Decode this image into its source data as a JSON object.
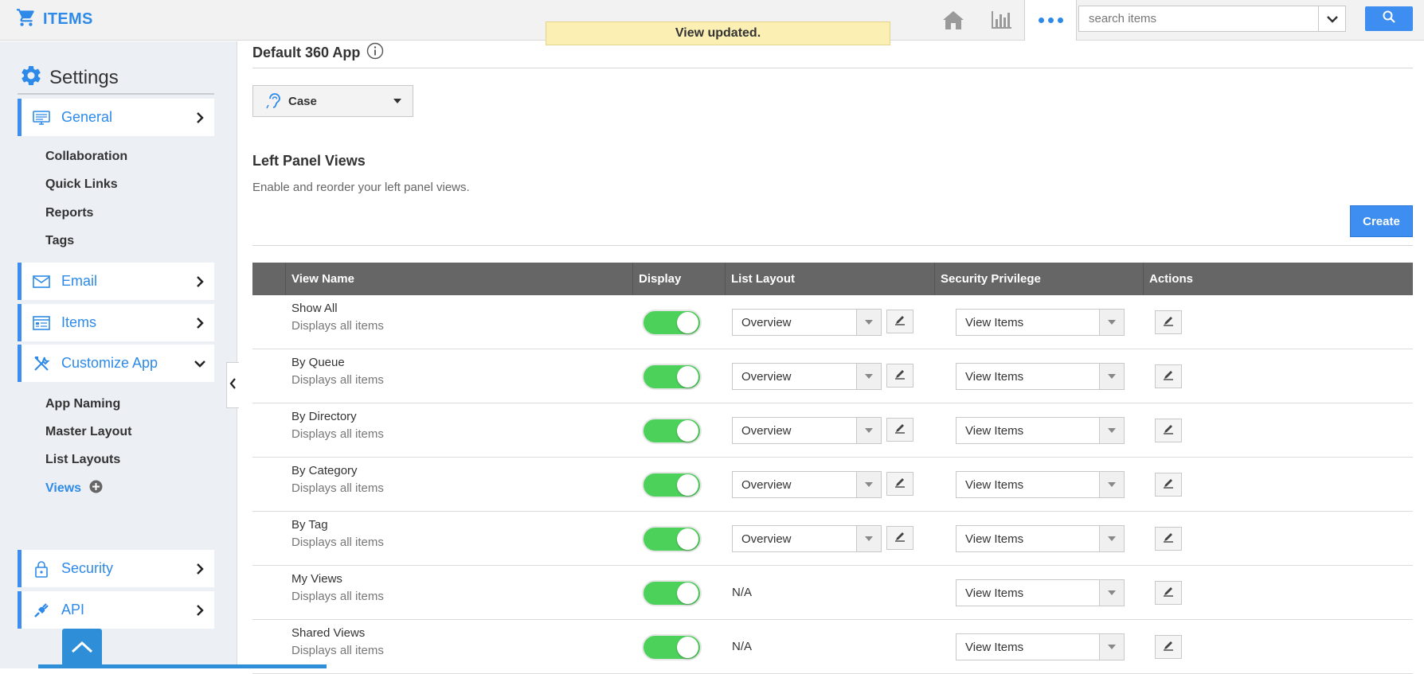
{
  "header": {
    "brand": "ITEMS",
    "search_placeholder": "search items",
    "icons": [
      "cart-icon",
      "home-icon",
      "bar-chart-icon",
      "more-icon",
      "chevron-down-icon",
      "search-icon"
    ]
  },
  "toast": "View updated.",
  "sidebar": {
    "title": "Settings",
    "sections": [
      {
        "label": "General",
        "icon": "monitor-icon",
        "expanded": false
      },
      {
        "label": "Email",
        "icon": "envelope-icon",
        "expanded": false
      },
      {
        "label": "Items",
        "icon": "list-window-icon",
        "expanded": false
      },
      {
        "label": "Customize App",
        "icon": "tools-icon",
        "expanded": true
      },
      {
        "label": "Security",
        "icon": "lock-icon",
        "expanded": false
      },
      {
        "label": "API",
        "icon": "plug-icon",
        "expanded": false
      }
    ],
    "general_sub": [
      "Collaboration",
      "Quick Links",
      "Reports",
      "Tags"
    ],
    "customize_sub": [
      "App Naming",
      "Master Layout",
      "List Layouts",
      "Views"
    ]
  },
  "main": {
    "app_title": "Default 360 App",
    "app_select": "Case",
    "section_title": "Left Panel Views",
    "section_desc": "Enable and reorder your left panel views.",
    "create_label": "Create",
    "columns": [
      "View Name",
      "Display",
      "List Layout",
      "Security Privilege",
      "Actions"
    ],
    "rows": [
      {
        "name": "Show All",
        "desc": "Displays all items",
        "display": true,
        "layout": "Overview",
        "privilege": "View Items"
      },
      {
        "name": "By Queue",
        "desc": "Displays all items",
        "display": true,
        "layout": "Overview",
        "privilege": "View Items"
      },
      {
        "name": "By Directory",
        "desc": "Displays all items",
        "display": true,
        "layout": "Overview",
        "privilege": "View Items"
      },
      {
        "name": "By Category",
        "desc": "Displays all items",
        "display": true,
        "layout": "Overview",
        "privilege": "View Items"
      },
      {
        "name": "By Tag",
        "desc": "Displays all items",
        "display": true,
        "layout": "Overview",
        "privilege": "View Items"
      },
      {
        "name": "My Views",
        "desc": "Displays all items",
        "display": true,
        "layout": "N/A",
        "privilege": "View Items"
      },
      {
        "name": "Shared Views",
        "desc": "Displays all items",
        "display": true,
        "layout": "N/A",
        "privilege": "View Items"
      }
    ]
  },
  "colors": {
    "accent": "#3d8ef0",
    "toggle_on": "#4cd15a",
    "toast_bg": "#fbefb4",
    "table_header": "#666666"
  }
}
